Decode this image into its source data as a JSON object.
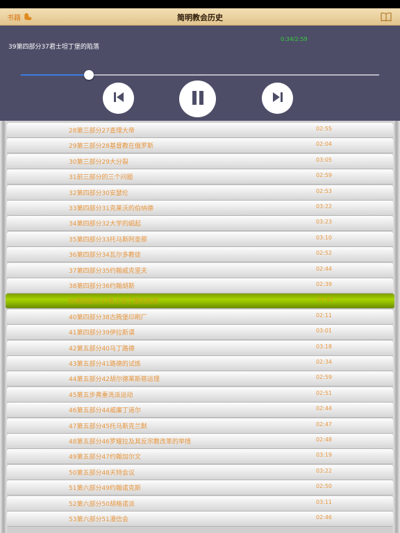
{
  "nav": {
    "back_label": "书籍",
    "title": "简明教会历史"
  },
  "player": {
    "now_playing": "39第四部分37君士坦丁堡的陷落",
    "time": "0:34/2:59",
    "progress": 0.19,
    "colors": {
      "background": "#4d4d68",
      "time": "#37d23a",
      "track_fill": "#3b7de0"
    }
  },
  "tracks": [
    {
      "title": "28第三部分27查理大帝",
      "duration": "02:55"
    },
    {
      "title": "29第三部分28基督教在俄罗斯",
      "duration": "02:04"
    },
    {
      "title": "30第三部分29大分裂",
      "duration": "03:05"
    },
    {
      "title": "31前三部分的三个问题",
      "duration": "02:59"
    },
    {
      "title": "32第四部分30安瑟伦",
      "duration": "02:53"
    },
    {
      "title": "33第四部分31克莱沃的伯纳德",
      "duration": "03:22"
    },
    {
      "title": "34第四部分32大学的崛起",
      "duration": "03:23"
    },
    {
      "title": "35第四部分33托马斯阿奎那",
      "duration": "03:10"
    },
    {
      "title": "36第四部分34瓦尔多教徒",
      "duration": "02:52"
    },
    {
      "title": "37第四部分35约翰威克里夫",
      "duration": "02:44"
    },
    {
      "title": "38第四部分36约翰胡斯",
      "duration": "02:39"
    },
    {
      "title": "39第四部分37君士坦丁堡的陷落",
      "duration": "01:42",
      "active": true
    },
    {
      "title": "40第四部分38古腾堡印刷厂",
      "duration": "02:11"
    },
    {
      "title": "41第四部分39伊拉斯谟",
      "duration": "03:01"
    },
    {
      "title": "42第五部分40马丁路德",
      "duration": "03:18"
    },
    {
      "title": "43第五部分41路德的试炼",
      "duration": "02:34"
    },
    {
      "title": "44第五部分42胡尔德莱斯慈运理",
      "duration": "02:59"
    },
    {
      "title": "45第五步弗重洗派运动",
      "duration": "02:51"
    },
    {
      "title": "46第五部分44威廉丁道尔",
      "duration": "02:44"
    },
    {
      "title": "47第五部分45托马斯克兰默",
      "duration": "02:47"
    },
    {
      "title": "48第五部分46罗耀拉及其反宗教改革的举措",
      "duration": "02:48"
    },
    {
      "title": "49第五部分47约翰加尔文",
      "duration": "03:19"
    },
    {
      "title": "50第五部分48天特会议",
      "duration": "03:22"
    },
    {
      "title": "51第六部分49约翰诺克斯",
      "duration": "02:50"
    },
    {
      "title": "52第六部分50胡格诺派",
      "duration": "03:11"
    },
    {
      "title": "53第六部分51漫信会",
      "duration": "02:46"
    }
  ],
  "icons": {
    "back": "duck-icon",
    "book": "book-icon",
    "prev": "skip-previous-icon",
    "pause": "pause-icon",
    "next": "skip-next-icon"
  },
  "colors": {
    "track_text": "#e7963e",
    "active_row": "#a8d200"
  }
}
